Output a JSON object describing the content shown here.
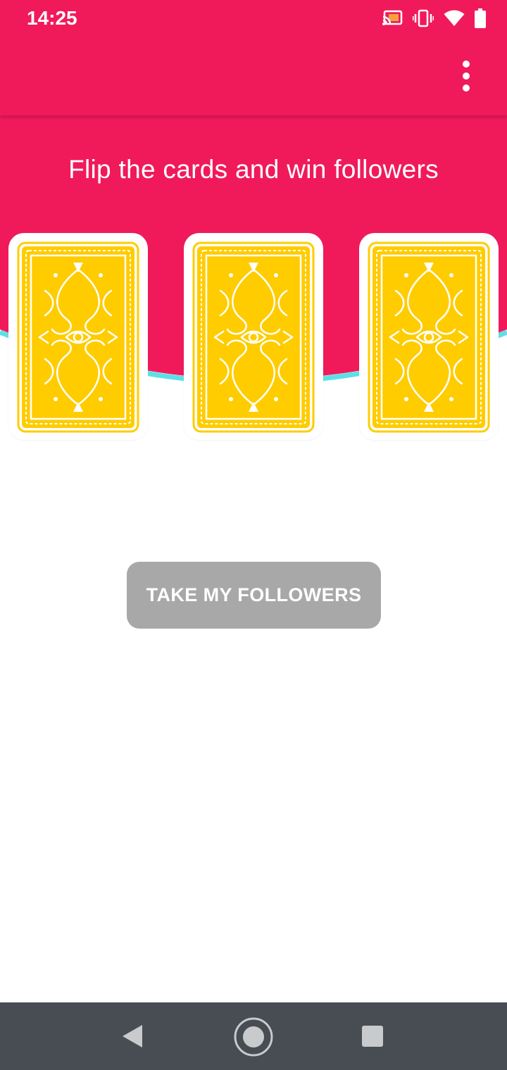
{
  "status_bar": {
    "time": "14:25",
    "icons": [
      "cast-icon",
      "vibrate-icon",
      "wifi-icon",
      "battery-icon"
    ]
  },
  "app_bar": {
    "menu_icon": "more-vert-icon",
    "background_color": "#f01a5b"
  },
  "main": {
    "headline": "Flip the cards and win followers",
    "cards": [
      {
        "id": "card-1",
        "face": "back"
      },
      {
        "id": "card-2",
        "face": "back"
      },
      {
        "id": "card-3",
        "face": "back"
      }
    ],
    "action_button_label": "TAKE MY FOLLOWERS",
    "card_color": "#ffcc00",
    "arc_accent_color": "#5ce0e8"
  },
  "nav_bar": {
    "buttons": [
      "back-icon",
      "home-icon",
      "recents-icon"
    ]
  }
}
